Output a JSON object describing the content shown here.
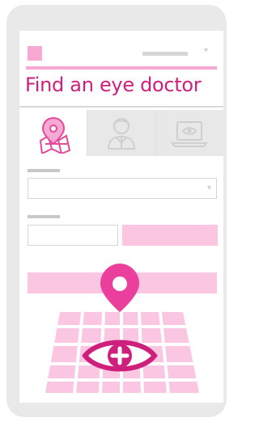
{
  "app": {
    "title": "Find an eye doctor"
  },
  "tabs": [
    {
      "name": "location",
      "icon": "map-pin-icon",
      "active": true
    },
    {
      "name": "doctor",
      "icon": "doctor-icon",
      "active": false
    },
    {
      "name": "online",
      "icon": "laptop-eye-icon",
      "active": false
    }
  ],
  "colors": {
    "accent": "#cf1f7c",
    "accent_light": "#f7a9d3",
    "button_fill": "#fbc6e2",
    "pin": "#ea3f9d"
  }
}
